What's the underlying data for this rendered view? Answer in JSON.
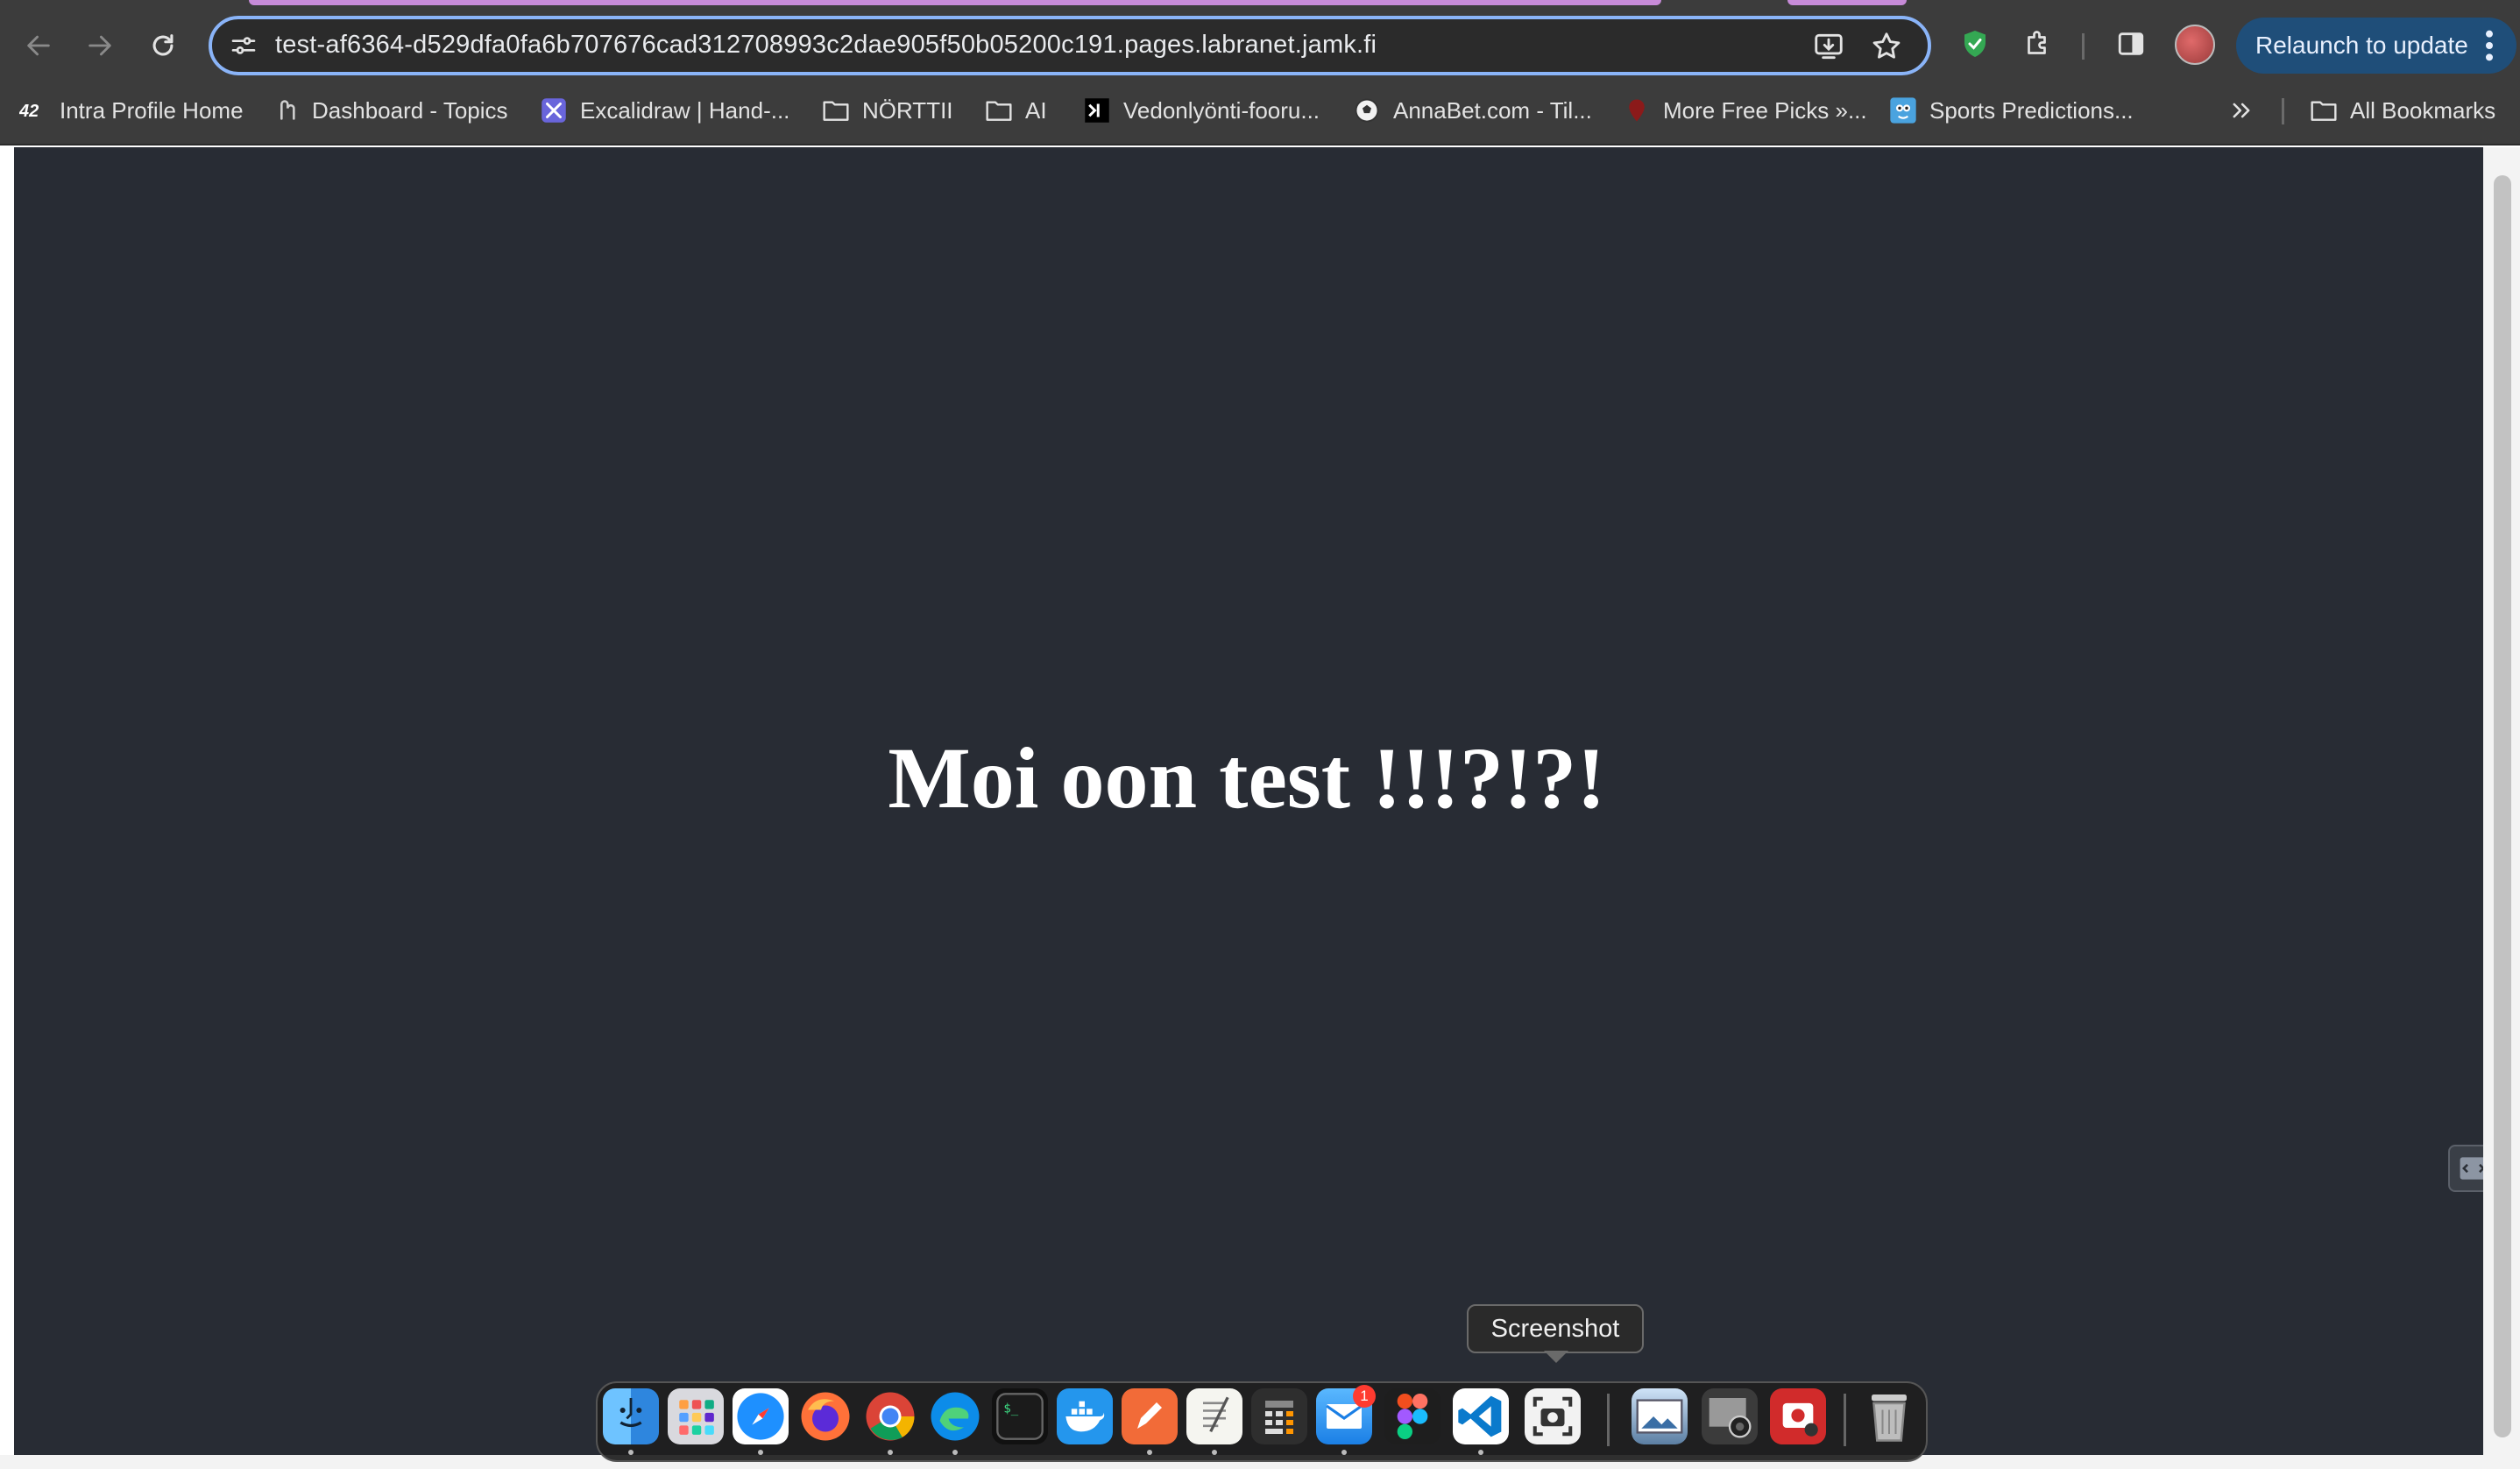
{
  "browser": {
    "url": "test-af6364-d529dfa0fa6b707676cad312708993c2dae905f50b05200c191.pages.labranet.jamk.fi",
    "relaunch_label": "Relaunch to update",
    "bookmarks": [
      {
        "label": "Intra Profile Home",
        "icon": "intra-logo-icon"
      },
      {
        "label": "Dashboard - Topics",
        "icon": "dashboard-favicon-icon"
      },
      {
        "label": "Excalidraw | Hand-...",
        "icon": "excalidraw-favicon-icon"
      },
      {
        "label": "NÖRTTII",
        "icon": "folder-icon"
      },
      {
        "label": "AI",
        "icon": "folder-icon"
      },
      {
        "label": "Vedonlyönti-fooru...",
        "icon": "terminal-favicon-icon"
      },
      {
        "label": "AnnaBet.com - Til...",
        "icon": "soccer-ball-icon"
      },
      {
        "label": "More Free Picks »...",
        "icon": "picks-favicon-icon"
      },
      {
        "label": "Sports Predictions...",
        "icon": "sports-favicon-icon"
      }
    ],
    "all_bookmarks_label": "All Bookmarks"
  },
  "page": {
    "heading": "Moi oon test !!!?!?!"
  },
  "dock": {
    "tooltip": "Screenshot",
    "mail_badge": "1",
    "apps": [
      "Finder",
      "Launchpad",
      "Safari",
      "Firefox",
      "Chrome",
      "Edge",
      "Terminal",
      "Docker",
      "Pages",
      "TextEdit",
      "Calculator",
      "Mail",
      "Figma",
      "Visual Studio Code",
      "Screenshot",
      "Preview",
      "Image Capture",
      "Photo Booth",
      "Trash"
    ]
  },
  "colors": {
    "page_background": "#282c34",
    "chrome_background": "#3c3c3c",
    "omnibox_focus": "#8ab4f8",
    "relaunch_button": "#1f4e79"
  }
}
